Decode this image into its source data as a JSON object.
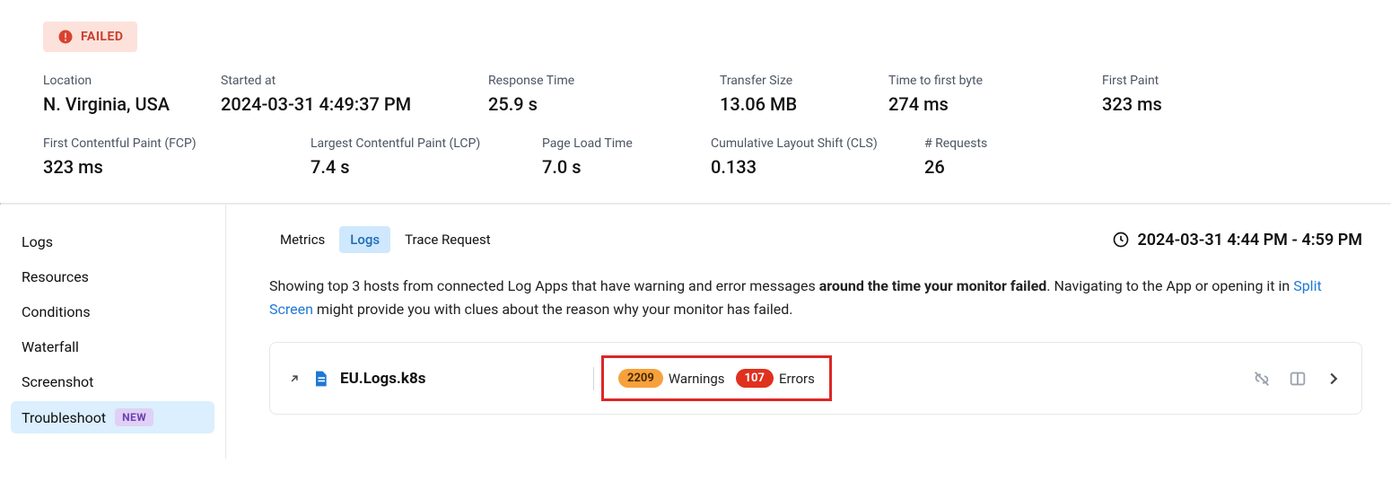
{
  "status": {
    "label": "FAILED"
  },
  "metrics": {
    "location": {
      "label": "Location",
      "value": "N. Virginia, USA"
    },
    "started_at": {
      "label": "Started at",
      "value": "2024-03-31 4:49:37 PM"
    },
    "response_time": {
      "label": "Response Time",
      "value": "25.9 s"
    },
    "transfer_size": {
      "label": "Transfer Size",
      "value": "13.06 MB"
    },
    "ttfb": {
      "label": "Time to first byte",
      "value": "274 ms"
    },
    "first_paint": {
      "label": "First Paint",
      "value": "323 ms"
    },
    "fcp": {
      "label": "First Contentful Paint (FCP)",
      "value": "323 ms"
    },
    "lcp": {
      "label": "Largest Contentful Paint (LCP)",
      "value": "7.4 s"
    },
    "page_load_time": {
      "label": "Page Load Time",
      "value": "7.0 s"
    },
    "cls": {
      "label": "Cumulative Layout Shift (CLS)",
      "value": "0.133"
    },
    "requests": {
      "label": "# Requests",
      "value": "26"
    }
  },
  "sidebar": {
    "items": [
      {
        "label": "Logs"
      },
      {
        "label": "Resources"
      },
      {
        "label": "Conditions"
      },
      {
        "label": "Waterfall"
      },
      {
        "label": "Screenshot"
      },
      {
        "label": "Troubleshoot",
        "badge": "NEW"
      }
    ]
  },
  "content": {
    "tabs": [
      {
        "label": "Metrics"
      },
      {
        "label": "Logs"
      },
      {
        "label": "Trace Request"
      }
    ],
    "time_range": "2024-03-31 4:44 PM - 4:59 PM",
    "description": {
      "part1": "Showing top 3 hosts from connected Log Apps that have warning and error messages ",
      "bold": "around the time your monitor failed",
      "part2": ". Navigating to the App or opening it in ",
      "link": "Split Screen",
      "part3": " might provide you with clues about the reason why your monitor has failed."
    },
    "log_item": {
      "title": "EU.Logs.k8s",
      "warnings_count": "2209",
      "warnings_label": "Warnings",
      "errors_count": "107",
      "errors_label": "Errors"
    }
  }
}
